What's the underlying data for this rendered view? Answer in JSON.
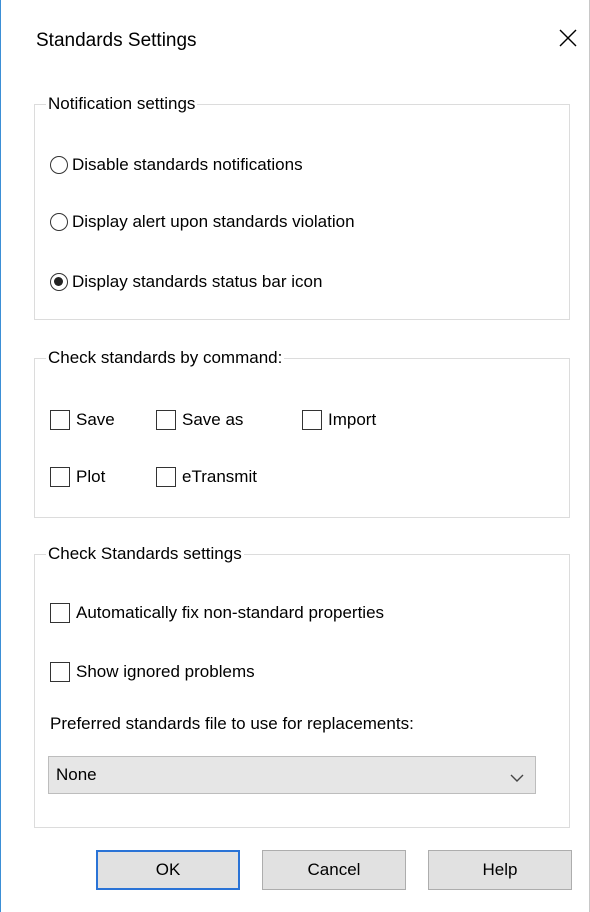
{
  "dialog": {
    "title": "Standards Settings"
  },
  "notification": {
    "legend": "Notification settings",
    "options": [
      {
        "label": "Disable standards notifications",
        "checked": false
      },
      {
        "label": "Display alert upon standards violation",
        "checked": false
      },
      {
        "label": "Display standards status bar icon",
        "checked": true
      }
    ]
  },
  "by_command": {
    "legend": "Check standards by command:",
    "items": [
      {
        "label": "Save",
        "checked": false
      },
      {
        "label": "Save as",
        "checked": false
      },
      {
        "label": "Import",
        "checked": false
      },
      {
        "label": "Plot",
        "checked": false
      },
      {
        "label": "eTransmit",
        "checked": false
      }
    ]
  },
  "check_settings": {
    "legend": "Check Standards settings",
    "auto_fix": {
      "label": "Automatically fix non-standard properties",
      "checked": false
    },
    "show_ignored": {
      "label": "Show ignored problems",
      "checked": false
    },
    "preferred_label": "Preferred standards file to use for replacements:",
    "preferred_value": "None"
  },
  "buttons": {
    "ok": "OK",
    "cancel": "Cancel",
    "help": "Help"
  },
  "colors": {
    "accent": "#2a73d6",
    "button_bg": "#e1e1e1",
    "select_bg": "#e6e6e6"
  }
}
